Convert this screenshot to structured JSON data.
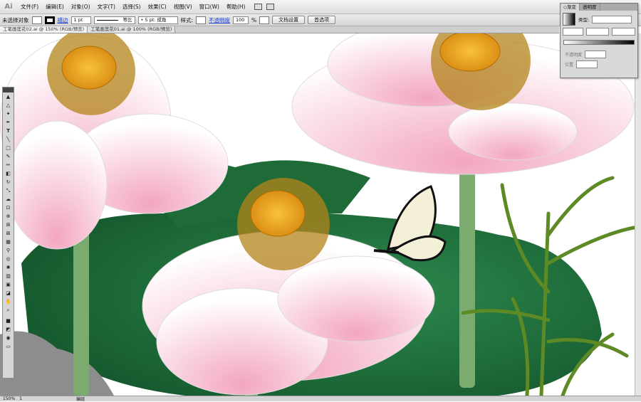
{
  "app": {
    "logo": "Ai"
  },
  "menu": [
    "文件(F)",
    "编辑(E)",
    "对象(O)",
    "文字(T)",
    "选择(S)",
    "效果(C)",
    "视图(V)",
    "窗口(W)",
    "帮助(H)"
  ],
  "control": {
    "selection": "未选择对象",
    "stroke_label": "描边",
    "stroke_value": "1 pt",
    "profile": "等比",
    "brush": "• 5 pt. 成角",
    "style_label": "样式:",
    "opacity_label": "不透明度",
    "opacity_value": "100",
    "opacity_unit": "%",
    "doc_setup": "文档设置",
    "prefs": "首选项"
  },
  "tabs": [
    {
      "label": "工笔画莲花02.ai @ 150% (RGB/预览)",
      "active": true
    },
    {
      "label": "工笔画莲花01.ai @ 100% (RGB/预览)",
      "active": false
    }
  ],
  "panel": {
    "tab_gradient": "◇渐变",
    "tab_transparency": "透明度",
    "type_label": "类型:",
    "opacity_label": "不透明度",
    "position_label": "位置"
  },
  "status": {
    "zoom": "150%",
    "page": "1",
    "mode": "编组"
  },
  "colors": {
    "leaf": "#1f6b3a",
    "petal": "#f6c9d6",
    "seed": "#e8a21a",
    "stem": "#7aab6e",
    "bamboo": "#6f9a2c"
  }
}
